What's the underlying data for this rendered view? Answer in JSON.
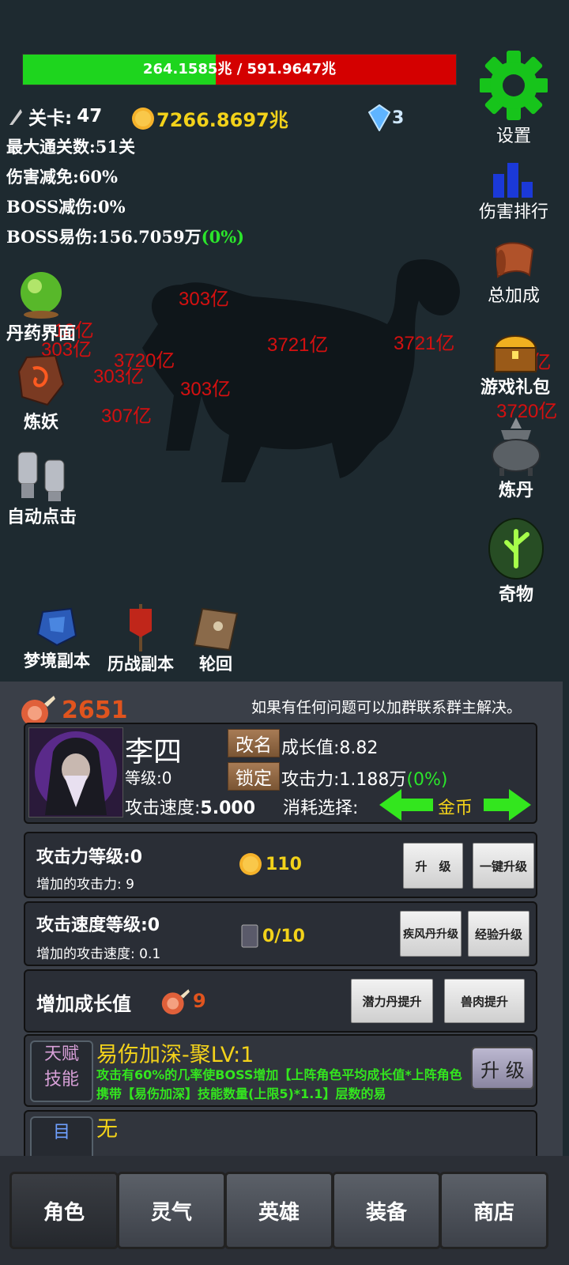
{
  "boss": {
    "hp_current": "264.1585兆",
    "hp_sep": " / ",
    "hp_max": "591.9647兆",
    "hp_fraction": 0.446
  },
  "stats": {
    "stage_label": "关卡:",
    "stage_value": "47",
    "gold": "7266.8697兆",
    "gems": "3",
    "max_clear": "最大通关数:51关",
    "dmg_reduction": "伤害减免:60%",
    "boss_reduction": "BOSS减伤:0%",
    "boss_vuln": "BOSS易伤:156.7059万",
    "boss_vuln_pct": "(0%)"
  },
  "damage_numbers": [
    "303亿",
    "3721亿",
    "3721亿",
    "303亿",
    "3720亿",
    "303亿",
    "303亿",
    "307亿",
    "10亿",
    "0亿",
    "3720亿"
  ],
  "left_menu": {
    "pill": "丹药界面",
    "demon": "炼妖",
    "auto": "自动点击"
  },
  "right_menu": {
    "settings": "设置",
    "rank": "伤害排行",
    "bonus": "总加成",
    "gift": "游戏礼包",
    "alchemy": "炼丹",
    "oddity": "奇物"
  },
  "dungeons": {
    "dream": "梦境副本",
    "battle": "历战副本",
    "reincarnate": "轮回"
  },
  "panel": {
    "meat": "2651",
    "notice": "如果有任何问题可以加群联系群主解决。",
    "hero": {
      "name": "李四",
      "rename": "改名",
      "lock": "锁定",
      "level": "等级:0",
      "growth": "成长值:8.82",
      "attack": "攻击力:1.188万",
      "attack_pct": "(0%)",
      "speed_label": "攻击速度:",
      "speed_value": "5.000",
      "consume_label": "消耗选择:",
      "consume_value": "金币"
    },
    "atk_row": {
      "title": "攻击力等级:0",
      "sub_label": "增加的攻击力:",
      "sub_value": "9",
      "cost": "110",
      "btn1": "升　级",
      "btn2": "一键升级"
    },
    "spd_row": {
      "title": "攻击速度等级:0",
      "sub_label": "增加的攻击速度:",
      "sub_value": "0.1",
      "cost": "0/10",
      "btn1": "疾风丹升级",
      "btn2": "经验升级"
    },
    "growth_row": {
      "title": "增加成长值",
      "cost": "9",
      "btn1": "潜力丹提升",
      "btn2": "兽肉提升"
    },
    "skill": {
      "tag1": "天赋",
      "tag2": "技能",
      "name": "易伤加深-聚LV:1",
      "desc": "攻击有60%的几率使BOSS增加【上阵角色平均成长值*上阵角色携带【易伤加深】技能数量(上限5)*1.1】层数的易",
      "btn": "升 级",
      "next_tag": "目",
      "next_name": "无"
    }
  },
  "tabs": [
    "角色",
    "灵气",
    "英雄",
    "装备",
    "商店"
  ]
}
